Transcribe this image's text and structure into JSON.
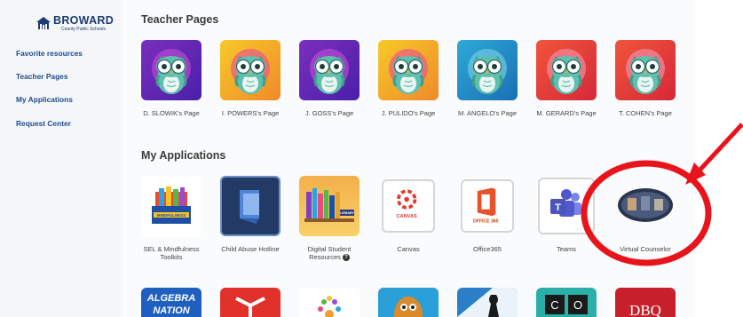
{
  "brand": {
    "name": "BROWARD",
    "sub": "County Public Schools"
  },
  "sidebar": {
    "items": [
      {
        "label": "Favorite resources"
      },
      {
        "label": "Teacher Pages"
      },
      {
        "label": "My Applications"
      },
      {
        "label": "Request Center"
      }
    ]
  },
  "sections": {
    "teacher_pages": {
      "title": "Teacher Pages",
      "tiles": [
        {
          "label": "D. SLOWIK's Page"
        },
        {
          "label": "I. POWERS's Page"
        },
        {
          "label": "J. GOSS's Page"
        },
        {
          "label": "J. PULIDO's Page"
        },
        {
          "label": "M. ANGELO's Page"
        },
        {
          "label": "M. GERARD's Page"
        },
        {
          "label": "T. COHEN's Page"
        }
      ]
    },
    "my_applications": {
      "title": "My Applications",
      "tiles": [
        {
          "label": "SEL & Mindfulness Toolkits",
          "icon_text": "MINDFULNESS"
        },
        {
          "label": "Child Abuse Hotline"
        },
        {
          "label": "Digital Student Resources",
          "icon_text": "LIBRARY"
        },
        {
          "label": "Canvas",
          "icon_text": "CANVAS"
        },
        {
          "label": "Office365",
          "icon_text": "OFFICE 365"
        },
        {
          "label": "Teams"
        },
        {
          "label": "Virtual Counselor"
        }
      ],
      "row3": [
        {
          "icon_text": "ALGEBRA",
          "icon_text2": "NATION"
        },
        {
          "icon_text": ""
        },
        {
          "icon_text": ""
        },
        {
          "icon_text": ""
        },
        {
          "icon_text": ""
        },
        {
          "icon_text": "C",
          "icon_text2": "O"
        },
        {
          "icon_text": "DBQ"
        }
      ]
    }
  },
  "colors": {
    "brand_blue": "#1d3b73",
    "annotation_red": "#e8141b"
  }
}
